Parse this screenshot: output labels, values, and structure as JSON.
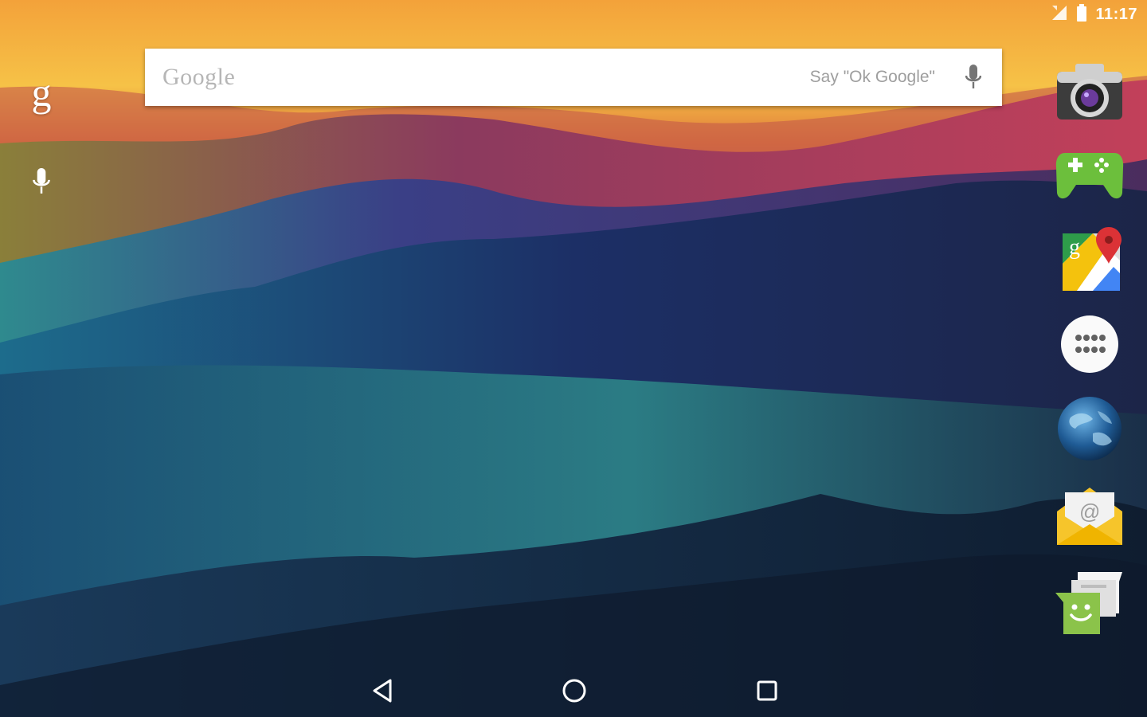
{
  "status_bar": {
    "time": "11:17",
    "icons": [
      "no-sim-icon",
      "battery-icon"
    ]
  },
  "search_bar": {
    "logo_text": "Google",
    "hint": "Say \"Ok Google\"",
    "mic_icon": "mic-icon"
  },
  "side_panel": {
    "google_glyph": "g",
    "mic_icon": "mic-icon"
  },
  "dock_apps": [
    {
      "name": "Camera",
      "icon": "camera-icon"
    },
    {
      "name": "Play Games",
      "icon": "gamepad-icon"
    },
    {
      "name": "Maps",
      "icon": "maps-icon"
    },
    {
      "name": "All apps",
      "icon": "app-drawer-icon"
    },
    {
      "name": "Browser",
      "icon": "globe-icon"
    },
    {
      "name": "Email",
      "icon": "email-icon"
    },
    {
      "name": "Messenger",
      "icon": "messaging-icon"
    }
  ],
  "nav_bar": [
    "back-icon",
    "home-icon",
    "recents-icon"
  ],
  "colors": {
    "search_bg": "#ffffff",
    "hint_text": "#9e9e9e",
    "games_green": "#6cbf3c",
    "email_yellow": "#f6c52b"
  }
}
